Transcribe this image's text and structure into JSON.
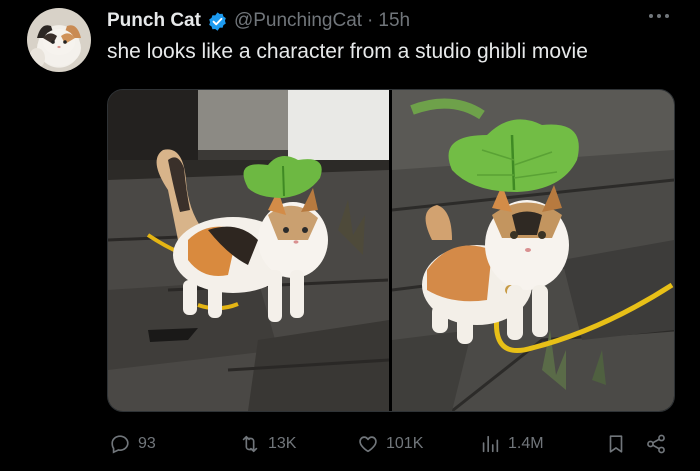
{
  "post": {
    "author_name": "Punch Cat",
    "handle": "@PunchingCat",
    "separator": "·",
    "time": "15h",
    "text": "she looks like a character from a studio ghibli movie",
    "verified": true
  },
  "media": {
    "count": 2
  },
  "actions": {
    "replies": "93",
    "reposts": "13K",
    "likes": "101K",
    "views": "1.4M"
  },
  "icons": {
    "verified": "verified-badge-icon",
    "more": "more-dots-icon",
    "reply": "reply-icon",
    "repost": "repost-icon",
    "like": "heart-icon",
    "views": "views-bars-icon",
    "bookmark": "bookmark-icon",
    "share": "share-icon"
  },
  "colors": {
    "background": "#000000",
    "primary_text": "#e7e9ea",
    "secondary_text": "#71767b",
    "verified_blue": "#1d9bf0"
  }
}
